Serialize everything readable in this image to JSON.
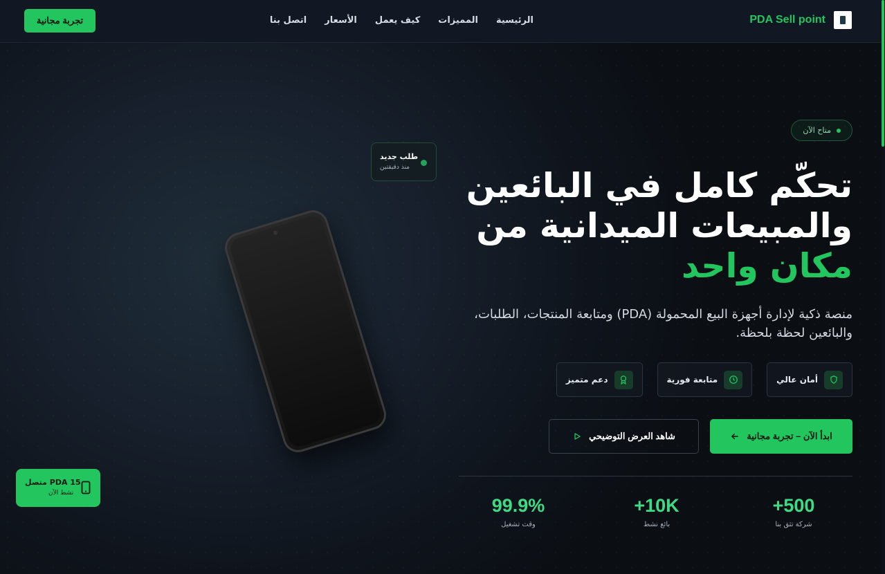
{
  "nav": {
    "brand_name": "PDA Sell point",
    "links": [
      "الرئيسية",
      "المميزات",
      "كيف يعمل",
      "الأسعار",
      "اتصل بنا"
    ],
    "cta": "تجربة مجانية"
  },
  "hero": {
    "badge": "متاح الآن",
    "headline_line1": "تحكّم كامل في البائعين",
    "headline_line2": "والمبيعات الميدانية من",
    "headline_line3": "مكان واحد",
    "subtitle": "منصة ذكية لإدارة أجهزة البيع المحمولة (PDA) ومتابعة المنتجات، الطلبات، والبائعين لحظة بلحظة.",
    "features": [
      {
        "label": "أمان عالي",
        "icon": "shield-icon"
      },
      {
        "label": "متابعة فورية",
        "icon": "clock-icon"
      },
      {
        "label": "دعم متميز",
        "icon": "award-icon"
      }
    ],
    "primary_button": "ابدأ الآن – تجربة مجانية",
    "secondary_button": "شاهد العرض التوضيحي",
    "stats": [
      {
        "value": "+500",
        "label": "شركة تثق بنا"
      },
      {
        "value": "+10K",
        "label": "بائع نشط"
      },
      {
        "value": "99.9%",
        "label": "وقت تشغيل"
      }
    ]
  },
  "floating": {
    "order_title": "طلب جديد",
    "order_time": "منذ دقيقتين",
    "pda_title": "PDA 15 متصل",
    "pda_status": "نشط الآن"
  },
  "colors": {
    "accent": "#22c55e",
    "background": "#0f141c"
  }
}
